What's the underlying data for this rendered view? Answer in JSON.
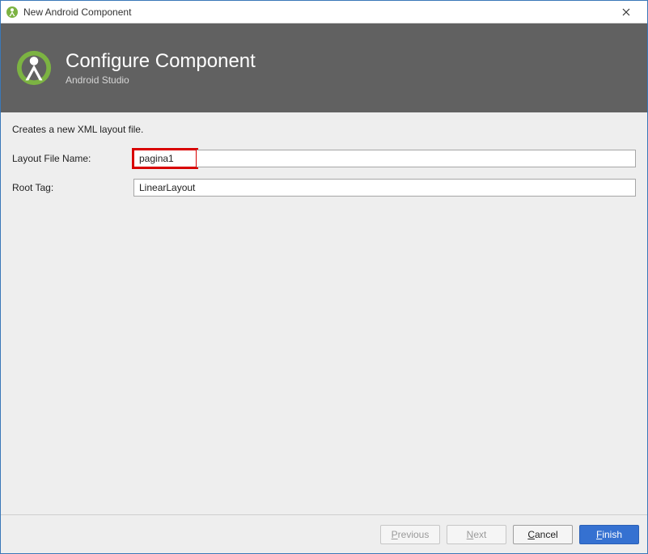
{
  "window": {
    "title": "New Android Component"
  },
  "header": {
    "title": "Configure Component",
    "subtitle": "Android Studio"
  },
  "body": {
    "description": "Creates a new XML layout file.",
    "layout_file_name_label": "Layout File Name:",
    "layout_file_name_value": "pagina1",
    "root_tag_label": "Root Tag:",
    "root_tag_value": "LinearLayout"
  },
  "footer": {
    "previous": "Previous",
    "next": "Next",
    "cancel": "Cancel",
    "finish": "Finish"
  }
}
